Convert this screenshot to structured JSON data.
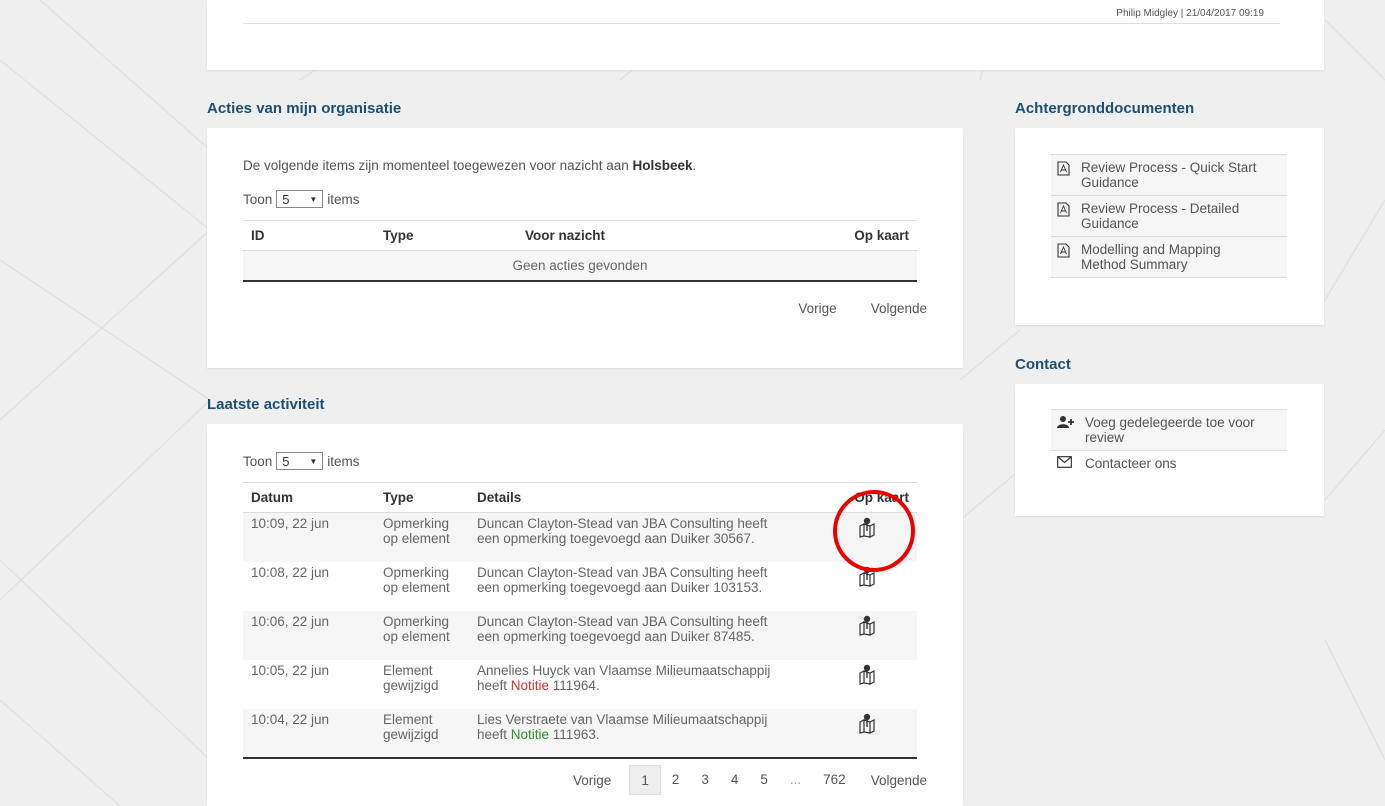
{
  "header": {
    "meta": "Philip Midgley | 21/04/2017 09:19"
  },
  "acties": {
    "title": "Acties van mijn organisatie",
    "intro_prefix": "De volgende items zijn momenteel toegewezen voor nazicht aan ",
    "organisation": "Holsbeek",
    "intro_suffix": ".",
    "toon_label": "Toon",
    "toon_value": "5",
    "items_label": "items",
    "columns": [
      "ID",
      "Type",
      "Voor nazicht",
      "Op kaart"
    ],
    "empty_message": "Geen acties gevonden",
    "prev": "Vorige",
    "next": "Volgende"
  },
  "activity": {
    "title": "Laatste activiteit",
    "toon_label": "Toon",
    "toon_value": "5",
    "items_label": "items",
    "columns": [
      "Datum",
      "Type",
      "Details",
      "Op kaart"
    ],
    "rows": [
      {
        "date": "10:09, 22 jun",
        "type1": "Opmerking",
        "type2": "op element",
        "line1": "Duncan Clayton-Stead van JBA Consulting heeft",
        "line2_pre": "een opmerking toegevoegd aan Duiker 30567.",
        "line2_link": "",
        "line2_post": ""
      },
      {
        "date": "10:08, 22 jun",
        "type1": "Opmerking",
        "type2": "op element",
        "line1": "Duncan Clayton-Stead van JBA Consulting heeft",
        "line2_pre": "een opmerking toegevoegd aan Duiker 103153.",
        "line2_link": "",
        "line2_post": ""
      },
      {
        "date": "10:06, 22 jun",
        "type1": "Opmerking",
        "type2": "op element",
        "line1": "Duncan Clayton-Stead van JBA Consulting heeft",
        "line2_pre": "een opmerking toegevoegd aan Duiker 87485.",
        "line2_link": "",
        "line2_post": ""
      },
      {
        "date": "10:05, 22 jun",
        "type1": "Element",
        "type2": "gewijzigd",
        "line1": "Annelies Huyck van Vlaamse Milieumaatschappij",
        "line2_pre": "heeft ",
        "line2_link": "Notitie",
        "line2_post": " 111964."
      },
      {
        "date": "10:04, 22 jun",
        "type1": "Element",
        "type2": "gewijzigd",
        "line1": "Lies Verstraete van Vlaamse Milieumaatschappij",
        "line2_pre": "heeft ",
        "line2_link": "Notitie",
        "line2_post": " 111963."
      }
    ],
    "pagination": {
      "prev": "Vorige",
      "pages": [
        "1",
        "2",
        "3",
        "4",
        "5",
        "...",
        "762"
      ],
      "next": "Volgende"
    }
  },
  "documents": {
    "title": "Achtergronddocumenten",
    "items": [
      {
        "l1": "Review Process - Quick Start",
        "l2": "Guidance",
        "icon": "pdf-icon"
      },
      {
        "l1": "Review Process - Detailed",
        "l2": "Guidance",
        "icon": "pdf-icon"
      },
      {
        "l1": "Modelling and Mapping",
        "l2": "Method Summary",
        "icon": "pdf-icon"
      }
    ]
  },
  "contact": {
    "title": "Contact",
    "items": [
      {
        "l1": "Voeg gedelegeerde toe voor",
        "l2": "review",
        "icon": "add-user-icon"
      },
      {
        "l1": "Contacteer ons",
        "l2": "",
        "icon": "envelope-icon"
      }
    ]
  },
  "colors": {
    "heading": "#1d4f6e",
    "notitie_red": "#d0342c",
    "notitie_green": "#2e8b2e",
    "highlight_circle": "#ee0000"
  }
}
